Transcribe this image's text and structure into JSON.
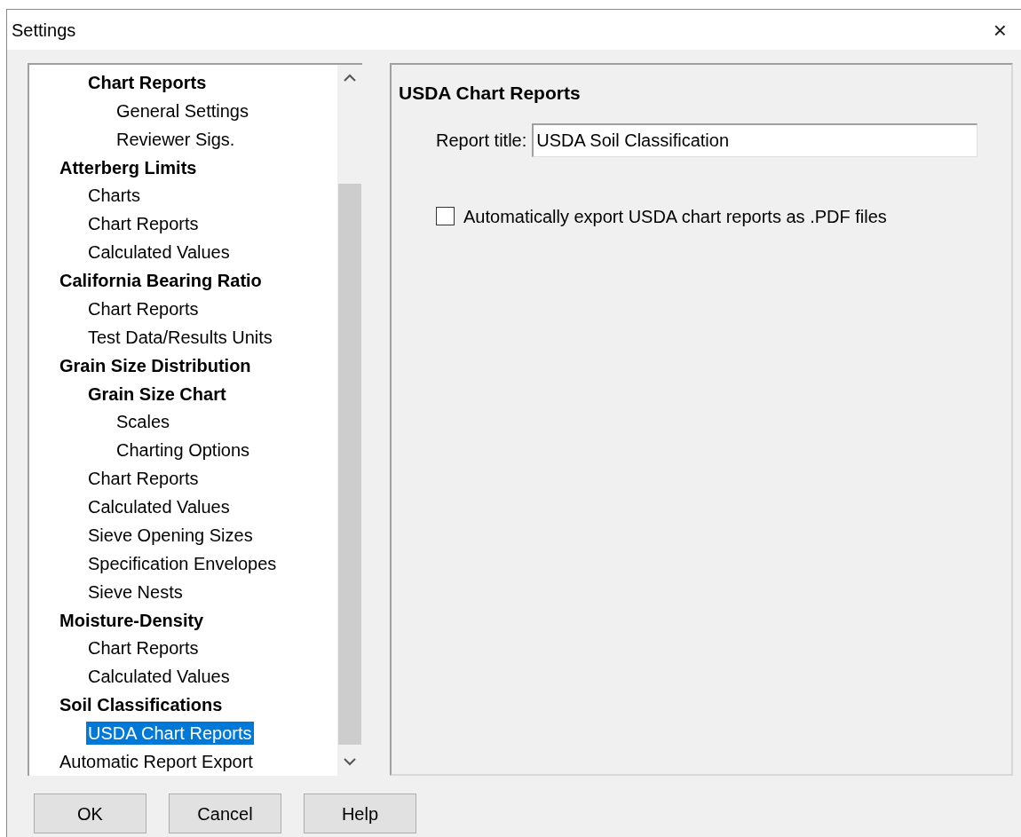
{
  "window": {
    "title": "Settings",
    "close": "×"
  },
  "tree": [
    {
      "children": [
        {
          "label": "Chart Reports",
          "kind": "category",
          "selected": false,
          "children": [
            {
              "label": "General Settings",
              "kind": "page",
              "selected": false
            },
            {
              "label": "Reviewer Sigs.",
              "kind": "page",
              "selected": false
            }
          ]
        }
      ]
    },
    {
      "label": "Atterberg Limits",
      "kind": "category",
      "selected": false,
      "children": [
        {
          "label": "Charts",
          "kind": "page",
          "selected": false
        },
        {
          "label": "Chart Reports",
          "kind": "page",
          "selected": false
        },
        {
          "label": "Calculated Values",
          "kind": "page",
          "selected": false
        }
      ]
    },
    {
      "label": "California Bearing Ratio",
      "kind": "category",
      "selected": false,
      "children": [
        {
          "label": "Chart Reports",
          "kind": "page",
          "selected": false
        },
        {
          "label": "Test Data/Results Units",
          "kind": "page",
          "selected": false
        }
      ]
    },
    {
      "label": "Grain Size Distribution",
      "kind": "category",
      "selected": false,
      "children": [
        {
          "label": "Grain Size Chart",
          "kind": "category",
          "selected": false,
          "children": [
            {
              "label": "Scales",
              "kind": "page",
              "selected": false
            },
            {
              "label": "Charting Options",
              "kind": "page",
              "selected": false
            }
          ]
        },
        {
          "label": "Chart Reports",
          "kind": "page",
          "selected": false
        },
        {
          "label": "Calculated Values",
          "kind": "page",
          "selected": false
        },
        {
          "label": "Sieve Opening Sizes",
          "kind": "page",
          "selected": false
        },
        {
          "label": "Specification Envelopes",
          "kind": "page",
          "selected": false
        },
        {
          "label": "Sieve Nests",
          "kind": "page",
          "selected": false
        }
      ]
    },
    {
      "label": "Moisture-Density",
      "kind": "category",
      "selected": false,
      "children": [
        {
          "label": "Chart Reports",
          "kind": "page",
          "selected": false
        },
        {
          "label": "Calculated Values",
          "kind": "page",
          "selected": false
        }
      ]
    },
    {
      "label": "Soil Classifications",
      "kind": "category",
      "selected": false,
      "children": [
        {
          "label": "USDA Chart Reports",
          "kind": "page",
          "selected": true
        }
      ]
    },
    {
      "label": "Automatic Report Export",
      "kind": "page",
      "selected": false
    }
  ],
  "panel": {
    "heading": "USDA Chart Reports",
    "report_title": {
      "label": "Report title:",
      "value": "USDA Soil Classification"
    },
    "checkbox": {
      "label": "Automatically export USDA chart reports as .PDF files",
      "checked": false
    }
  },
  "buttons": [
    "OK",
    "Cancel",
    "Help"
  ]
}
